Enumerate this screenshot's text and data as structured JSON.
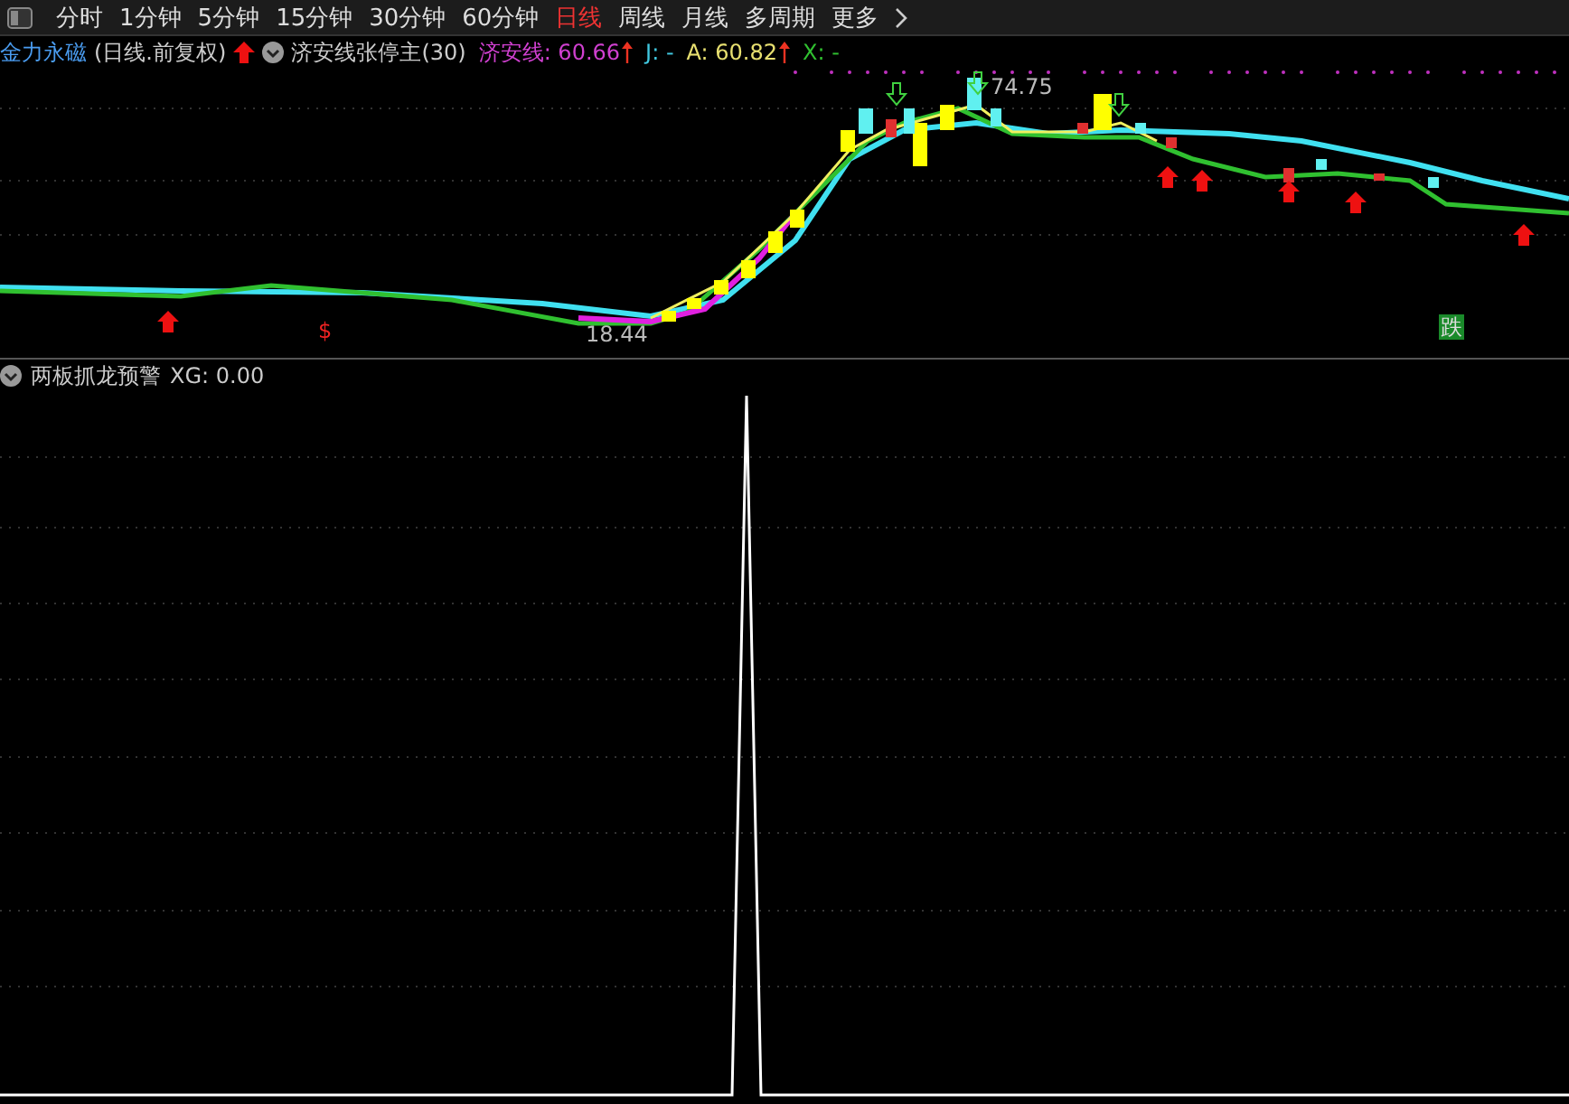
{
  "toolbar": {
    "tabs": [
      {
        "label": "分时",
        "selected": false
      },
      {
        "label": "1分钟",
        "selected": false
      },
      {
        "label": "5分钟",
        "selected": false
      },
      {
        "label": "15分钟",
        "selected": false
      },
      {
        "label": "30分钟",
        "selected": false
      },
      {
        "label": "60分钟",
        "selected": false
      },
      {
        "label": "日线",
        "selected": true
      },
      {
        "label": "周线",
        "selected": false
      },
      {
        "label": "月线",
        "selected": false
      },
      {
        "label": "多周期",
        "selected": false
      },
      {
        "label": "更多",
        "selected": false
      }
    ]
  },
  "main_panel": {
    "stock_name": "金力永磁",
    "period": "(日线.前复权)",
    "indicator": "济安线张停主(30)",
    "values": [
      {
        "label": "济安线:",
        "value": "60.66",
        "rising": true,
        "color": "#d040d0"
      },
      {
        "label": "J:",
        "value": "-",
        "rising": false,
        "color": "#40c8e0"
      },
      {
        "label": "A:",
        "value": "60.82",
        "rising": true,
        "color": "#e8e070"
      },
      {
        "label": "X:",
        "value": "-",
        "rising": false,
        "color": "#30c030"
      }
    ],
    "high_label": "74.75",
    "low_label": "18.44",
    "markers": [
      {
        "kind": "buy",
        "text": "$"
      },
      {
        "kind": "fall",
        "text": "跌"
      }
    ]
  },
  "sub_panel": {
    "indicator": "两板抓龙预警",
    "reading": "XG: 0.00"
  }
}
